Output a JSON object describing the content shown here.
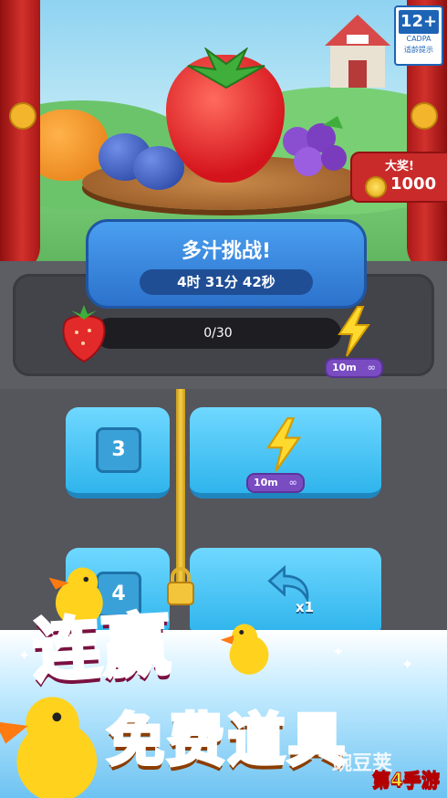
{
  "rating": {
    "age": "12+",
    "org": "CADPA",
    "note": "适龄提示"
  },
  "prize": {
    "label": "大奖!",
    "amount": "1000"
  },
  "challenge": {
    "title": "多汁挑战!",
    "timer": "4时 31分 42秒",
    "progress_text": "0/30",
    "progress_fraction": 0.0,
    "reward_duration": "10m",
    "reward_infinity": "∞"
  },
  "boosters": [
    {
      "number": "3",
      "reward_duration": "10m",
      "reward_infinity": "∞"
    },
    {
      "number": "4",
      "reward_multiplier": "x1"
    }
  ],
  "promo": {
    "line1": "连赢",
    "line2": "免费道具"
  },
  "watermark": {
    "brand_partial": "豌豆荚",
    "site": "第4手游"
  },
  "colors": {
    "accent_blue": "#2c72cc",
    "progress_red": "#ff5a55",
    "promo_pink": "#ff3b8a",
    "promo_orange": "#ff8a12"
  }
}
